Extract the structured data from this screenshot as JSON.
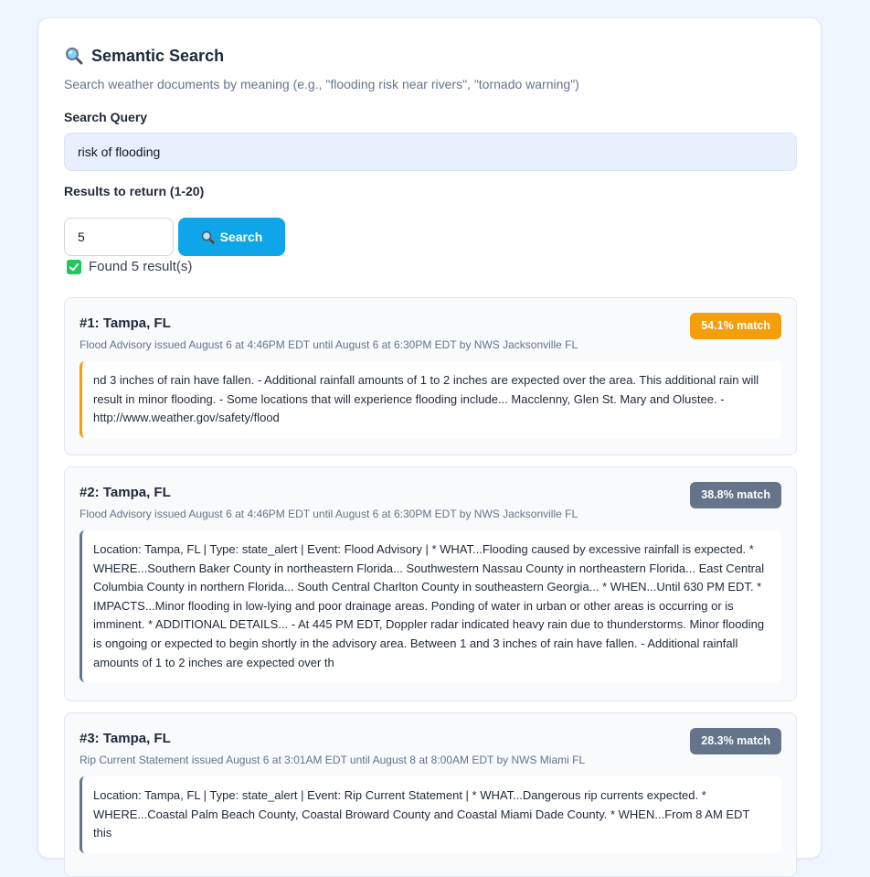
{
  "header": {
    "icon": "magnifying-glass-icon",
    "title": "Semantic Search",
    "subtitle": "Search weather documents by meaning (e.g., \"flooding risk near rivers\", \"tornado warning\")"
  },
  "search": {
    "query_label": "Search Query",
    "query_value": "risk of flooding",
    "count_label": "Results to return (1-20)",
    "count_value": "5",
    "button_label": "Search",
    "button_icon": "magnifying-glass-icon"
  },
  "status": {
    "icon": "check-mark-icon",
    "text": "Found 5 result(s)"
  },
  "colors": {
    "page_background": "#eff6ff",
    "search_button": "#0ea5e9",
    "high_match_badge": "#f59e0b",
    "low_match_badge": "#64748b"
  },
  "results": [
    {
      "title": "#1: Tampa, FL",
      "match": "54.1% match",
      "color": "#f59e0b",
      "meta": "Flood Advisory issued August 6 at 4:46PM EDT until August 6 at 6:30PM EDT by NWS Jacksonville FL",
      "excerpt": "nd 3 inches of rain have fallen. - Additional rainfall amounts of 1 to 2 inches are expected over the area. This additional rain will result in minor flooding. - Some locations that will experience flooding include... Macclenny, Glen St. Mary and Olustee. - http://www.weather.gov/safety/flood"
    },
    {
      "title": "#2: Tampa, FL",
      "match": "38.8% match",
      "color": "#64748b",
      "meta": "Flood Advisory issued August 6 at 4:46PM EDT until August 6 at 6:30PM EDT by NWS Jacksonville FL",
      "excerpt": "Location: Tampa, FL | Type: state_alert | Event: Flood Advisory | * WHAT...Flooding caused by excessive rainfall is expected. * WHERE...Southern Baker County in northeastern Florida... Southwestern Nassau County in northeastern Florida... East Central Columbia County in northern Florida... South Central Charlton County in southeastern Georgia... * WHEN...Until 630 PM EDT. * IMPACTS...Minor flooding in low-lying and poor drainage areas. Ponding of water in urban or other areas is occurring or is imminent. * ADDITIONAL DETAILS... - At 445 PM EDT, Doppler radar indicated heavy rain due to thunderstorms. Minor flooding is ongoing or expected to begin shortly in the advisory area. Between 1 and 3 inches of rain have fallen. - Additional rainfall amounts of 1 to 2 inches are expected over th"
    },
    {
      "title": "#3: Tampa, FL",
      "match": "28.3% match",
      "color": "#64748b",
      "meta": "Rip Current Statement issued August 6 at 3:01AM EDT until August 8 at 8:00AM EDT by NWS Miami FL",
      "excerpt": "Location: Tampa, FL | Type: state_alert | Event: Rip Current Statement | * WHAT...Dangerous rip currents expected. * WHERE...Coastal Palm Beach County, Coastal Broward County and Coastal Miami Dade County. * WHEN...From 8 AM EDT this"
    }
  ]
}
